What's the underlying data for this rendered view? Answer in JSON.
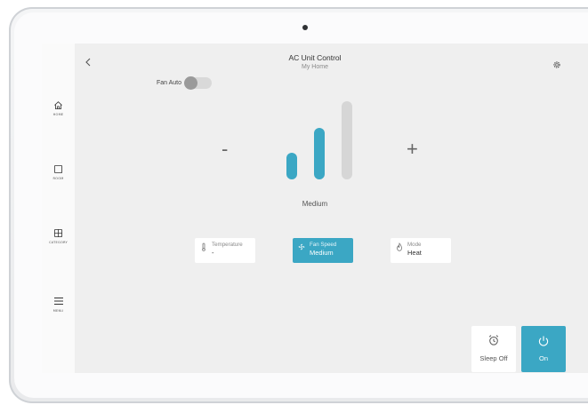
{
  "header": {
    "title": "AC Unit Control",
    "subtitle": "My Home"
  },
  "sidebar": {
    "items": [
      {
        "label": "HOME",
        "icon": "home-icon"
      },
      {
        "label": "ROOM",
        "icon": "room-icon"
      },
      {
        "label": "CATEGORY",
        "icon": "category-icon"
      },
      {
        "label": "MENU",
        "icon": "menu-icon"
      }
    ]
  },
  "fan_auto": {
    "label": "Fan Auto",
    "on": false
  },
  "controls": {
    "minus": "-",
    "plus": "+"
  },
  "fan_speed": {
    "current": "Medium",
    "level": 2,
    "levels": 3
  },
  "cards": {
    "temperature": {
      "label": "Temperature",
      "value": "-"
    },
    "fan_speed": {
      "label": "Fan Speed",
      "value": "Medium"
    },
    "mode": {
      "label": "Mode",
      "value": "Heat"
    }
  },
  "buttons": {
    "sleep": "Sleep Off",
    "power": "On"
  },
  "colors": {
    "accent": "#3ba7c4",
    "inactive_bar": "#d6d6d6",
    "background": "#efefef"
  }
}
